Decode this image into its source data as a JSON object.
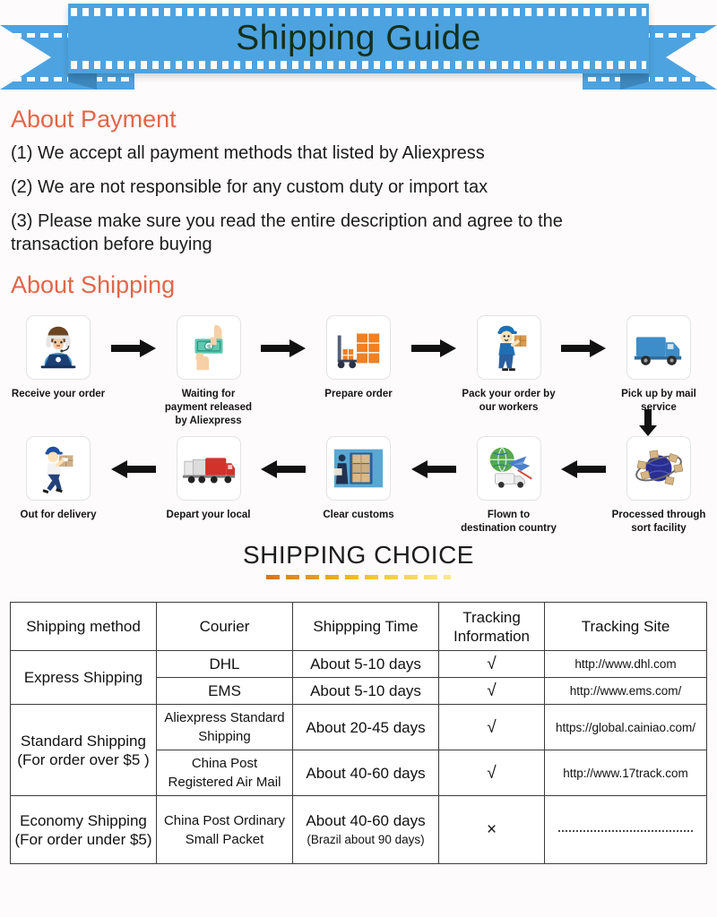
{
  "banner": {
    "title": "Shipping Guide",
    "color": "#4da3e0"
  },
  "payment": {
    "heading": "About Payment",
    "heading_color": "#e2664a",
    "items": [
      "(1) We accept all payment methods that listed by Aliexpress",
      "(2) We are not responsible for any custom duty or import tax",
      "(3) Please make sure you read the entire description and agree to the transaction before buying"
    ]
  },
  "shipping": {
    "heading": "About Shipping",
    "flow_row1": [
      {
        "icon": "customer-support-laptop-icon",
        "label": "Receive your order"
      },
      {
        "icon": "cash-handover-icon",
        "label": "Waiting for payment released by Aliexpress"
      },
      {
        "icon": "forklift-boxes-icon",
        "label": "Prepare order"
      },
      {
        "icon": "worker-carrying-package-icon",
        "label": "Pack your order by our workers"
      },
      {
        "icon": "delivery-truck-icon",
        "label": "Pick up by mail service"
      }
    ],
    "flow_row2": [
      {
        "icon": "courier-walking-package-icon",
        "label": "Out for delivery"
      },
      {
        "icon": "truck-fleet-icon",
        "label": "Depart your local"
      },
      {
        "icon": "customs-warehouse-icon",
        "label": "Clear customs"
      },
      {
        "icon": "globe-airplane-icon",
        "label": "Flown to destination country"
      },
      {
        "icon": "sort-facility-globe-icon",
        "label": "Processed through sort facility"
      }
    ]
  },
  "choice": {
    "title": "SHIPPING CHOICE",
    "divider_colors": [
      "#d9741a",
      "#f0c020",
      "#fbe98a"
    ]
  },
  "table": {
    "headers": [
      "Shipping method",
      "Courier",
      "Shippping Time",
      "Tracking Information",
      "Tracking Site"
    ],
    "groups": [
      {
        "method": "Express Shipping",
        "method_note": "",
        "rows": [
          {
            "courier": "DHL",
            "time": "About 5-10 days",
            "time_note": "",
            "tracking": "√",
            "site": "http://www.dhl.com"
          },
          {
            "courier": "EMS",
            "time": "About 5-10 days",
            "time_note": "",
            "tracking": "√",
            "site": "http://www.ems.com/"
          }
        ]
      },
      {
        "method": "Standard Shipping",
        "method_note": "(For order over $5 )",
        "rows": [
          {
            "courier": "Aliexpress Standard Shipping",
            "time": "About 20-45 days",
            "time_note": "",
            "tracking": "√",
            "site": "https://global.cainiao.com/"
          },
          {
            "courier": "China Post Registered Air Mail",
            "time": "About 40-60 days",
            "time_note": "",
            "tracking": "√",
            "site": "http://www.17track.com"
          }
        ]
      },
      {
        "method": "Economy Shipping",
        "method_note": "(For order under $5)",
        "rows": [
          {
            "courier": "China Post Ordinary Small Packet",
            "time": "About 40-60 days",
            "time_note": "(Brazil about 90 days)",
            "tracking": "×",
            "site": ""
          }
        ]
      }
    ]
  }
}
